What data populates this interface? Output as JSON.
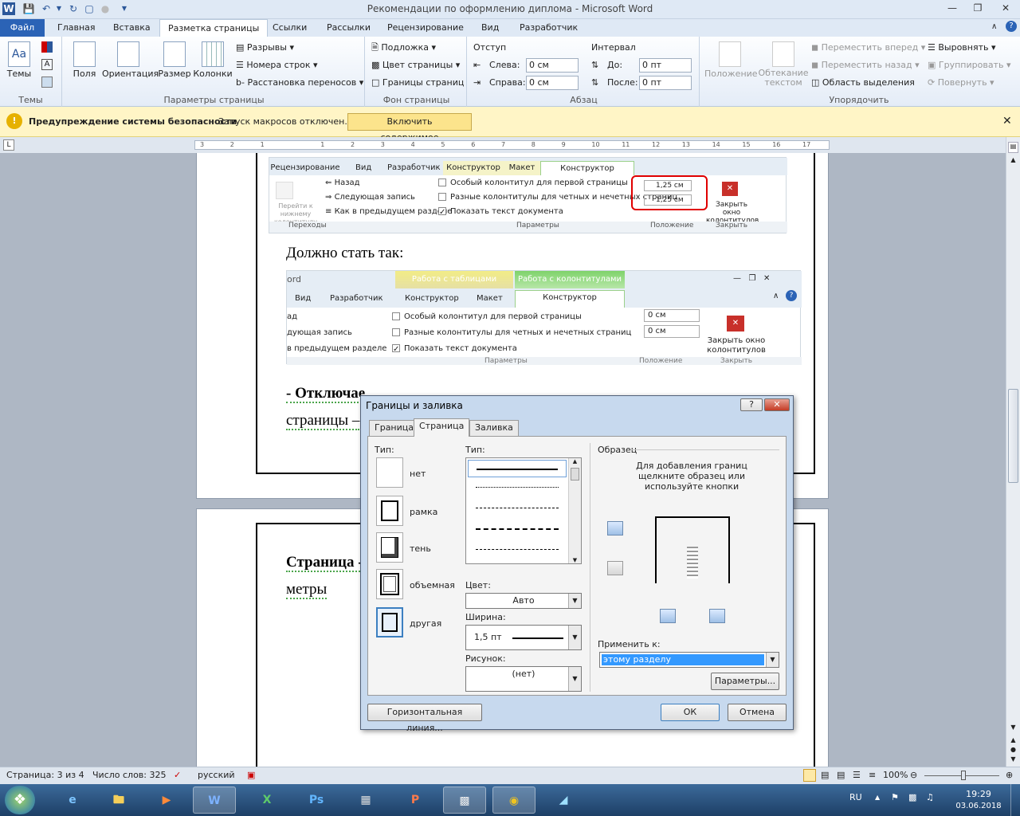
{
  "window": {
    "title": "Рекомендации по оформлению диплома  -  Microsoft Word",
    "app_icon": "W"
  },
  "tabs": [
    "Файл",
    "Главная",
    "Вставка",
    "Разметка страницы",
    "Ссылки",
    "Рассылки",
    "Рецензирование",
    "Вид",
    "Разработчик"
  ],
  "ribbon": {
    "themes": {
      "btn": "Темы",
      "group": "Темы"
    },
    "page_setup": {
      "margins": "Поля",
      "orientation": "Ориентация",
      "size": "Размер",
      "columns": "Колонки",
      "breaks": "Разрывы",
      "line_numbers": "Номера строк",
      "hyphenation": "Расстановка переносов",
      "group": "Параметры страницы"
    },
    "background": {
      "watermark": "Подложка",
      "page_color": "Цвет страницы",
      "page_borders": "Границы страниц",
      "group": "Фон страницы"
    },
    "paragraph": {
      "indent_title": "Отступ",
      "left_label": "Слева:",
      "left_val": "0 см",
      "right_label": "Справа:",
      "right_val": "0 см",
      "spacing_title": "Интервал",
      "before_label": "До:",
      "before_val": "0 пт",
      "after_label": "После:",
      "after_val": "0 пт",
      "group": "Абзац"
    },
    "arrange": {
      "position": "Положение",
      "wrap": "Обтекание текстом",
      "bring_forward": "Переместить вперед",
      "send_backward": "Переместить назад",
      "selection_pane": "Область выделения",
      "align": "Выровнять",
      "group_btn": "Группировать",
      "rotate": "Повернуть",
      "group": "Упорядочить"
    }
  },
  "security": {
    "title": "Предупреждение системы безопасности",
    "message": "Запуск макросов отключен.",
    "button": "Включить содержимое"
  },
  "ruler": {
    "numbers": [
      "3",
      "2",
      "1",
      "",
      "1",
      "2",
      "3",
      "4",
      "5",
      "6",
      "7",
      "8",
      "9",
      "10",
      "11",
      "12",
      "13",
      "14",
      "15",
      "16",
      "17"
    ]
  },
  "doc": {
    "shot1": {
      "tabs": [
        "Рецензирование",
        "Вид",
        "Разработчик",
        "Конструктор",
        "Макет",
        "Конструктор"
      ],
      "back": "Назад",
      "next": "Следующая запись",
      "link_prev": "Как в предыдущем разделе",
      "goto_footer": "Перейти к нижнему колонтитулу",
      "opt1": "Особый колонтитул для первой страницы",
      "opt2": "Разные колонтитулы для четных и нечетных страниц",
      "opt3": "Показать текст документа",
      "val1": "1,25 см",
      "val2": "1,25 см",
      "close": "Закрыть окно колонтитулов",
      "groups": [
        "Переходы",
        "Параметры",
        "Положение",
        "Закрыть"
      ]
    },
    "should_be": "Должно стать так:",
    "shot2": {
      "word": "ord",
      "ctx1": "Работа с таблицами",
      "ctx2": "Работа с колонтитулами",
      "tabs": [
        "Вид",
        "Разработчик",
        "Конструктор",
        "Макет",
        "Конструктор"
      ],
      "back": "ад",
      "next": "дующая запись",
      "link_prev": "в предыдущем разделе",
      "opt1": "Особый колонтитул для первой страницы",
      "opt2": "Разные колонтитулы для четных и нечетных страниц",
      "opt3": "Показать текст документа",
      "val1": "0 см",
      "val2": "0 см",
      "close": "Закрыть окно колонтитулов",
      "groups": [
        "Параметры",
        "Положение",
        "Закрыть"
      ]
    },
    "line1": "- Отключае",
    "line2": "страницы –",
    "line3": "Страница -",
    "line4": "метры"
  },
  "dialog": {
    "title": "Границы и заливка",
    "help": "?",
    "close": "✕",
    "tabs": [
      "Граница",
      "Страница",
      "Заливка"
    ],
    "type_label": "Тип:",
    "types": [
      "нет",
      "рамка",
      "тень",
      "объемная",
      "другая"
    ],
    "style_label": "Тип:",
    "color_label": "Цвет:",
    "color_val": "Авто",
    "width_label": "Ширина:",
    "width_val": "1,5 пт",
    "art_label": "Рисунок:",
    "art_val": "(нет)",
    "preview_label": "Образец",
    "preview_hint": "Для добавления границ щелкните образец или используйте кнопки",
    "apply_label": "Применить к:",
    "apply_val": "этому разделу",
    "options_btn": "Параметры...",
    "hline_btn": "Горизонтальная линия...",
    "ok": "ОК",
    "cancel": "Отмена"
  },
  "status": {
    "page": "Страница: 3 из 4",
    "words": "Число слов: 325",
    "lang": "русский",
    "zoom": "100%"
  },
  "taskbar": {
    "lang": "RU",
    "time": "19:29",
    "date": "03.06.2018"
  }
}
